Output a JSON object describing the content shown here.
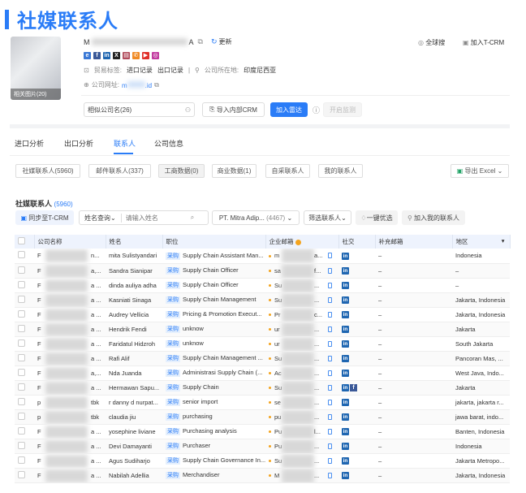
{
  "title": "社媒联系人",
  "company": {
    "name_start": "M",
    "name_end": "A",
    "refresh": "更新",
    "global_search": "全球搜",
    "add_tcrm": "加入T-CRM",
    "photos": "相关图片(20)",
    "trade_tags_label": "贸易标签:",
    "trade_tags": [
      "进口记录",
      "出口记录"
    ],
    "location_label": "公司所在地:",
    "location": "印度尼西亚",
    "website_label": "公司网址:",
    "website_start": "m",
    "website_end": ".id",
    "socials": [
      {
        "name": "website",
        "color": "#3a78d6",
        "g": "e"
      },
      {
        "name": "facebook",
        "color": "#3b5998",
        "g": "f"
      },
      {
        "name": "linkedin",
        "color": "#1f66b1",
        "g": "in"
      },
      {
        "name": "x",
        "color": "#222",
        "g": "X"
      },
      {
        "name": "fax",
        "color": "#b04a5a",
        "g": "▤"
      },
      {
        "name": "phone",
        "color": "#f08a24",
        "g": "✆"
      },
      {
        "name": "youtube",
        "color": "#e0302a",
        "g": "▶"
      },
      {
        "name": "instagram",
        "color": "#c23ba0",
        "g": "◎"
      }
    ]
  },
  "actions": {
    "similar": "相似公司名(26)",
    "import_crm": "导入内部CRM",
    "add_radar": "加入雷达",
    "monitor": "开启监测"
  },
  "tabs": [
    "进口分析",
    "出口分析",
    "联系人",
    "公司信息"
  ],
  "chips": [
    "社媒联系人(5960)",
    "邮件联系人(337)",
    "工商数据(0)",
    "商业数据(1)",
    "自采联系人",
    "我的联系人"
  ],
  "export": "导出 Excel",
  "section": {
    "title": "社媒联系人",
    "count": "(5960)"
  },
  "toolbar": {
    "sync": "同步至T-CRM",
    "name_query": "姓名查询",
    "name_placeholder": "请输入姓名",
    "company_filter": "PT. Mitra Adip...",
    "company_count": "(4467)",
    "filter": "筛选联系人",
    "optimize": "一键优选",
    "add_my": "加入我的联系人"
  },
  "columns": [
    "公司名称",
    "姓名",
    "职位",
    "企业邮箱",
    "社交",
    "补充邮箱",
    "地区"
  ],
  "tag": "采购",
  "rows": [
    {
      "c1": "F",
      "c2": "n...",
      "name": "mita Sulistyandari",
      "role": "Supply Chain Assistant Man...",
      "e1": "m",
      "e2": "a...",
      "fb": false,
      "extra": "–",
      "region": "Indonesia"
    },
    {
      "c1": "F",
      "c2": "a,...",
      "name": "Sandra Sianipar",
      "role": "Supply Chain Officer",
      "e1": "sa",
      "e2": "f...",
      "fb": false,
      "extra": "–",
      "region": "–"
    },
    {
      "c1": "F",
      "c2": "a ...",
      "name": "dinda auliya adha",
      "role": "Supply Chain Officer",
      "e1": "Su",
      "e2": "...",
      "fb": false,
      "extra": "–",
      "region": "–"
    },
    {
      "c1": "F",
      "c2": "a ...",
      "name": "Kasniati Sinaga",
      "role": "Supply Chain Management",
      "e1": "Su",
      "e2": "...",
      "fb": false,
      "extra": "–",
      "region": "Jakarta, Indonesia"
    },
    {
      "c1": "F",
      "c2": "a ...",
      "name": "Audrey Vellicia",
      "role": "Pricing & Promotion Execut...",
      "e1": "Pr",
      "e2": "c...",
      "fb": false,
      "extra": "–",
      "region": "Jakarta, Indonesia"
    },
    {
      "c1": "F",
      "c2": "a ...",
      "name": "Hendrik Fendi",
      "role": "unknow",
      "e1": "ur",
      "e2": "...",
      "fb": false,
      "extra": "–",
      "region": "Jakarta"
    },
    {
      "c1": "F",
      "c2": "a ...",
      "name": "Faridatul Hidzroh",
      "role": "unknow",
      "e1": "ur",
      "e2": "...",
      "fb": false,
      "extra": "–",
      "region": "South Jakarta"
    },
    {
      "c1": "F",
      "c2": "a ...",
      "name": "Rafi Alif",
      "role": "Supply Chain Management ...",
      "e1": "Su",
      "e2": "...",
      "fb": false,
      "extra": "–",
      "region": "Pancoran Mas, ..."
    },
    {
      "c1": "F",
      "c2": "a,...",
      "name": "Nda Juanda",
      "role": "Administrasi Supply Chain (...",
      "e1": "Ac",
      "e2": "...",
      "fb": false,
      "extra": "–",
      "region": "West Java, Indo..."
    },
    {
      "c1": "F",
      "c2": "a ...",
      "name": "Hermawan Sapu...",
      "role": "Supply Chain",
      "e1": "Su",
      "e2": "...",
      "fb": true,
      "extra": "–",
      "region": "Jakarta"
    },
    {
      "c1": "p",
      "c2": "tbk",
      "name": "r danny d nurpat...",
      "role": "senior import",
      "e1": "se",
      "e2": "...",
      "fb": false,
      "extra": "–",
      "region": "jakarta, jakarta r..."
    },
    {
      "c1": "p",
      "c2": "tbk",
      "name": "claudia jiu",
      "role": "purchasing",
      "e1": "pu",
      "e2": "...",
      "fb": false,
      "extra": "–",
      "region": "jawa barat, indo..."
    },
    {
      "c1": "F",
      "c2": "a ...",
      "name": "yosephine liviane",
      "role": "Purchasing analysis",
      "e1": "Pu",
      "e2": "l...",
      "fb": false,
      "extra": "–",
      "region": "Banten, Indonesia"
    },
    {
      "c1": "F",
      "c2": "a ...",
      "name": "Devi Damayanti",
      "role": "Purchaser",
      "e1": "Pu",
      "e2": "...",
      "fb": false,
      "extra": "–",
      "region": "Indonesia"
    },
    {
      "c1": "F",
      "c2": "a ...",
      "name": "Agus Sudiharjo",
      "role": "Supply Chain Governance In...",
      "e1": "Su",
      "e2": "...",
      "fb": false,
      "extra": "–",
      "region": "Jakarta Metropo..."
    },
    {
      "c1": "F",
      "c2": "a ...",
      "name": "Nabilah Adellia",
      "role": "Merchandiser",
      "e1": "M",
      "e2": "...",
      "fb": false,
      "extra": "–",
      "region": "Jakarta, Indonesia"
    }
  ]
}
